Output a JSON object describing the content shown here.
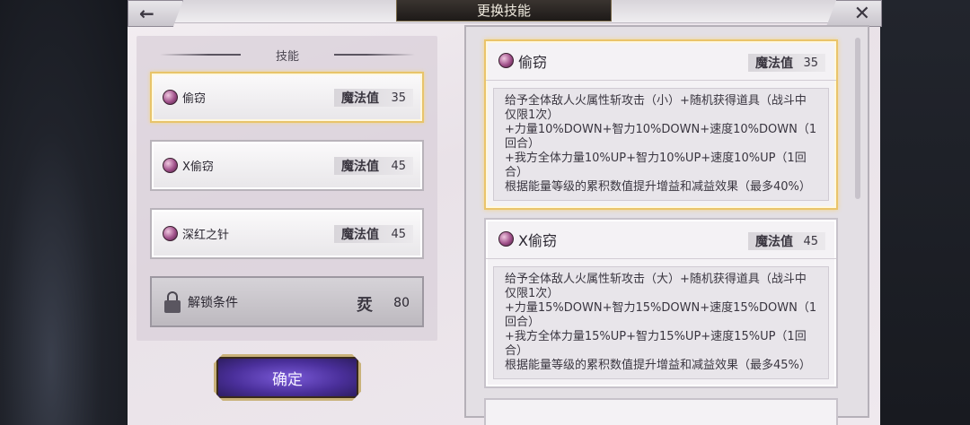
{
  "header": {
    "title": "更换技能",
    "back_icon": "←",
    "close_icon": "✕"
  },
  "skills_section": {
    "title": "技能",
    "items": [
      {
        "name": "偷窃",
        "mp_label": "魔法值",
        "mp": "35",
        "selected": true
      },
      {
        "name": "X偷窃",
        "mp_label": "魔法值",
        "mp": "45",
        "selected": false
      },
      {
        "name": "深红之针",
        "mp_label": "魔法值",
        "mp": "45",
        "selected": false
      }
    ],
    "locked": {
      "label": "解锁条件",
      "cond_icon": "烎",
      "value": "80"
    },
    "confirm_label": "确定"
  },
  "details": [
    {
      "name": "偷窃",
      "mp_label": "魔法值",
      "mp": "35",
      "lines": [
        "给予全体敌人火属性斩攻击（小）+随机获得道具（战斗中仅限1次）",
        "+力量10%DOWN+智力10%DOWN+速度10%DOWN（1回合）",
        "+我方全体力量10%UP+智力10%UP+速度10%UP（1回合）",
        "根据能量等级的累积数值提升增益和减益效果（最多40%）"
      ]
    },
    {
      "name": "X偷窃",
      "mp_label": "魔法值",
      "mp": "45",
      "lines": [
        "给予全体敌人火属性斩攻击（大）+随机获得道具（战斗中仅限1次）",
        "+力量15%DOWN+智力15%DOWN+速度15%DOWN（1回合）",
        "+我方全体力量15%UP+智力15%UP+速度15%UP（1回合）",
        "根据能量等级的累积数值提升增益和减益效果（最多45%）"
      ]
    }
  ]
}
